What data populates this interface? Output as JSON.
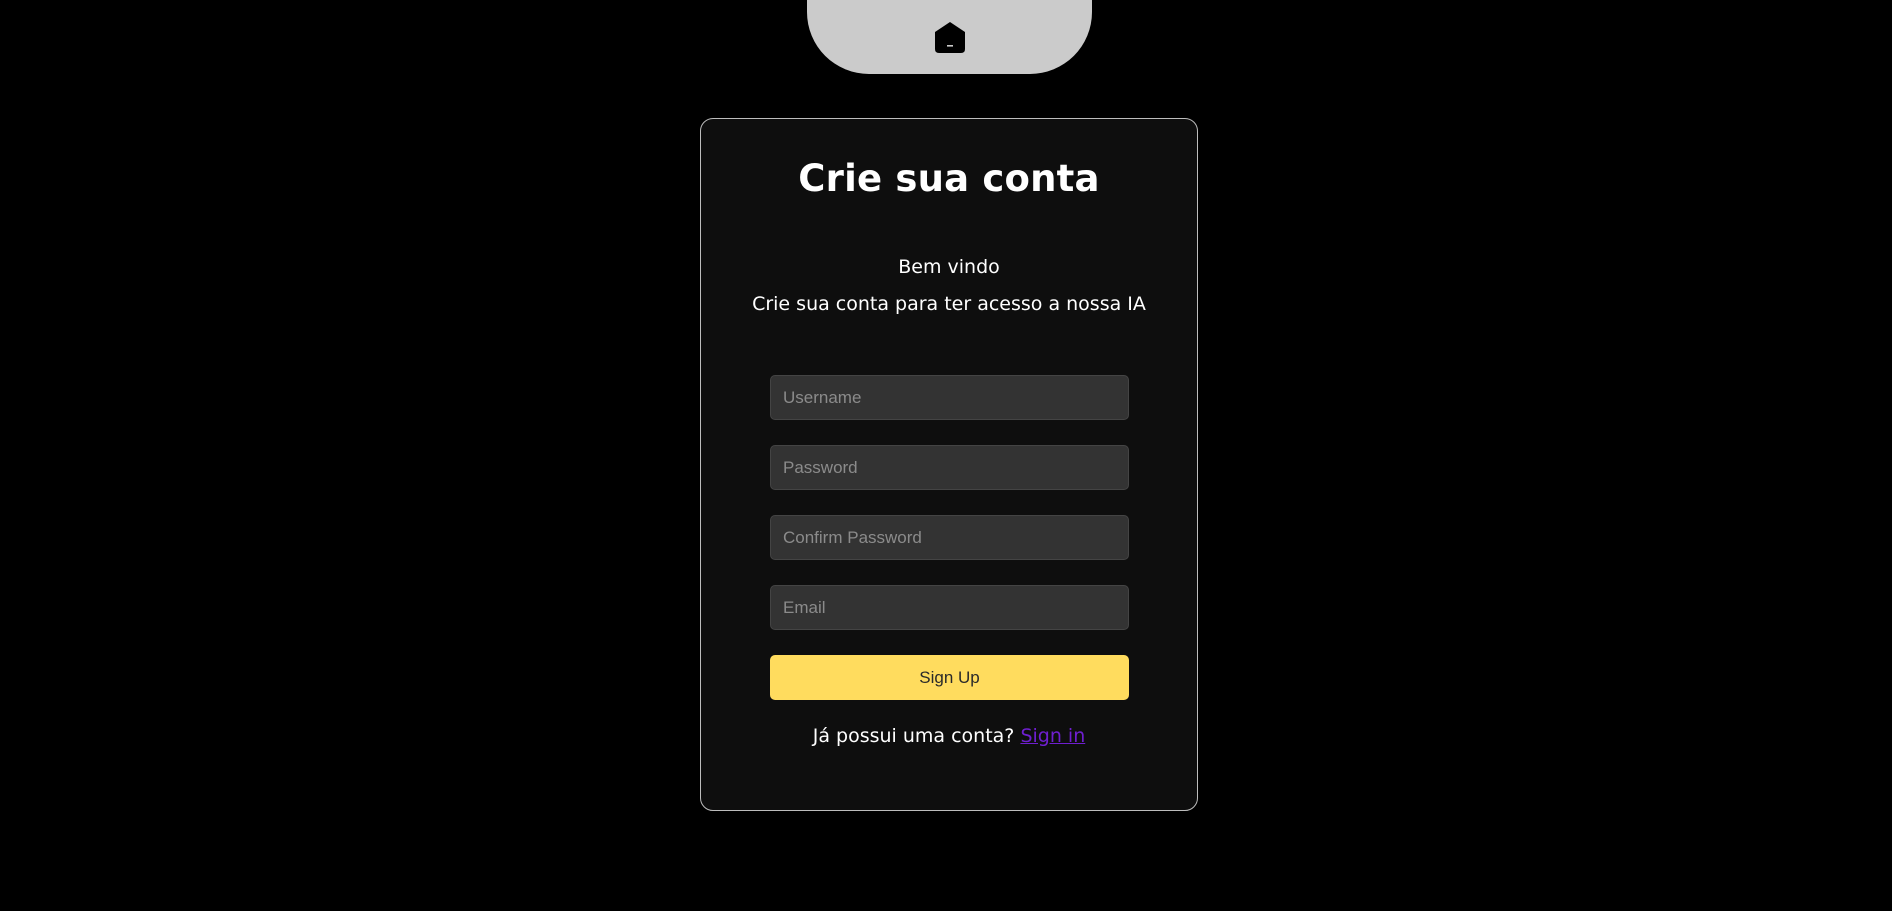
{
  "nav": {
    "home_icon": "home-icon"
  },
  "form": {
    "title": "Crie sua conta",
    "welcome": "Bem vindo",
    "subtitle": "Crie sua conta para ter acesso a nossa IA",
    "fields": {
      "username": {
        "placeholder": "Username",
        "value": ""
      },
      "password": {
        "placeholder": "Password",
        "value": ""
      },
      "confirm_password": {
        "placeholder": "Confirm Password",
        "value": ""
      },
      "email": {
        "placeholder": "Email",
        "value": ""
      }
    },
    "submit_label": "Sign Up",
    "signin_prompt": "Já possui uma conta?",
    "signin_link": "Sign in"
  },
  "colors": {
    "background": "#000000",
    "card": "#0e0e0e",
    "accent": "#ffdc5e",
    "link": "#6f1fd0",
    "home_tab": "#cbcbcb"
  }
}
